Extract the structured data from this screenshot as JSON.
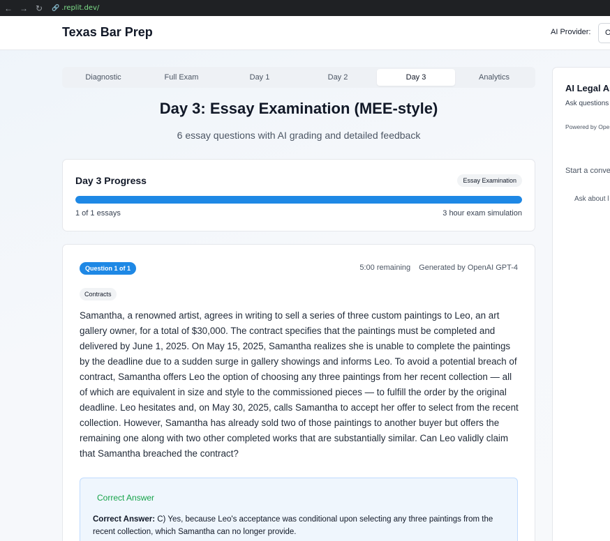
{
  "browser": {
    "url": ".replit.dev/"
  },
  "header": {
    "brand": "Texas Bar Prep",
    "provider_label": "AI Provider:",
    "provider_value": "O"
  },
  "tabs": [
    {
      "label": "Diagnostic",
      "active": false
    },
    {
      "label": "Full Exam",
      "active": false
    },
    {
      "label": "Day 1",
      "active": false
    },
    {
      "label": "Day 2",
      "active": false
    },
    {
      "label": "Day 3",
      "active": true
    },
    {
      "label": "Analytics",
      "active": false
    }
  ],
  "page": {
    "title": "Day 3: Essay Examination (MEE-style)",
    "subtitle": "6 essay questions with AI grading and detailed feedback"
  },
  "progress": {
    "title": "Day 3 Progress",
    "badge": "Essay Examination",
    "fraction": 1.0,
    "count_label": "1 of 1 essays",
    "simulation_label": "3 hour exam simulation"
  },
  "question": {
    "badge": "Question 1 of 1",
    "time_remaining": "5:00 remaining",
    "generated_by": "Generated by OpenAI GPT-4",
    "topic": "Contracts",
    "text": "Samantha, a renowned artist, agrees in writing to sell a series of three custom paintings to Leo, an art gallery owner, for a total of $30,000. The contract specifies that the paintings must be completed and delivered by June 1, 2025. On May 15, 2025, Samantha realizes she is unable to complete the paintings by the deadline due to a sudden surge in gallery showings and informs Leo. To avoid a potential breach of contract, Samantha offers Leo the option of choosing any three paintings from her recent collection — all of which are equivalent in size and style to the commissioned pieces — to fulfill the order by the original deadline. Leo hesitates and, on May 30, 2025, calls Samantha to accept her offer to select from the recent collection. However, Samantha has already sold two of those paintings to another buyer but offers the remaining one along with two other completed works that are substantially similar. Can Leo validly claim that Samantha breached the contract?",
    "answer_heading": "Correct Answer",
    "answer_label": "Correct Answer:",
    "answer_text": "C) Yes, because Leo's acceptance was conditional upon selecting any three paintings from the recent collection, which Samantha can no longer provide."
  },
  "ai_panel": {
    "title": "AI Legal As",
    "description": "Ask questions get study help",
    "powered_by": "Powered by Ope",
    "start_prompt": "Start a conve",
    "hint": "Ask about l strategies, o"
  },
  "colors": {
    "accent": "#1e88e5",
    "success": "#16a34a"
  }
}
